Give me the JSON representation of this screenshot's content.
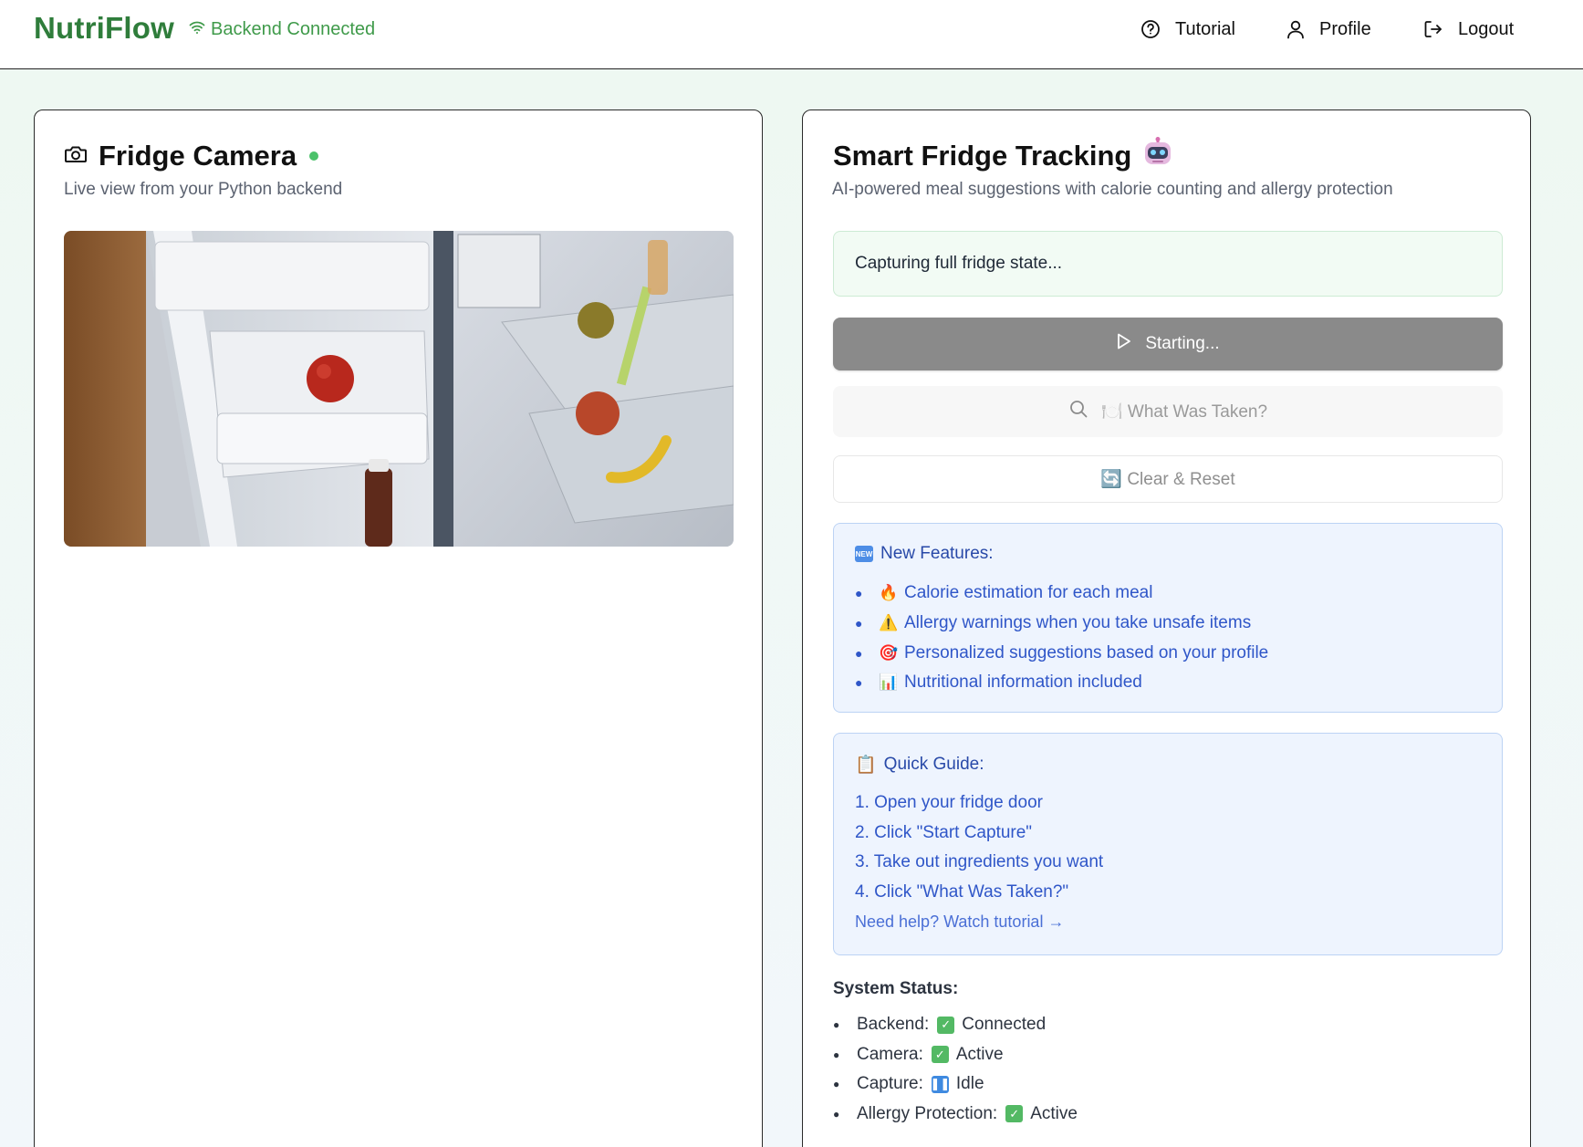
{
  "nav": {
    "brand": "NutriFlow",
    "connection_status": "Backend Connected",
    "tutorial": "Tutorial",
    "profile": "Profile",
    "logout": "Logout"
  },
  "camera_card": {
    "title": "Fridge Camera",
    "subtitle": "Live view from your Python backend",
    "live": true
  },
  "tracking_card": {
    "title": "Smart Fridge Tracking",
    "title_emoji": "🤖",
    "subtitle": "AI-powered meal suggestions with calorie counting and allergy protection",
    "status_message": "Capturing full fridge state...",
    "start_button": "Starting...",
    "what_taken_button": "🍽️ What Was Taken?",
    "clear_button": "🔄 Clear & Reset",
    "features": {
      "icon": "🆕",
      "title": "New Features:",
      "items": [
        {
          "emoji": "🔥",
          "text": "Calorie estimation for each meal"
        },
        {
          "emoji": "⚠️",
          "text": "Allergy warnings when you take unsafe items"
        },
        {
          "emoji": "🎯",
          "text": "Personalized suggestions based on your profile"
        },
        {
          "emoji": "📊",
          "text": "Nutritional information included"
        }
      ]
    },
    "guide": {
      "icon": "📋",
      "title": "Quick Guide:",
      "steps": [
        "1. Open your fridge door",
        "2. Click \"Start Capture\"",
        "3. Take out ingredients you want",
        "4. Click \"What Was Taken?\""
      ],
      "help_link": "Need help? Watch tutorial →"
    },
    "system_status": {
      "title": "System Status:",
      "items": [
        {
          "label": "Backend:",
          "value": "Connected",
          "icon": "check",
          "color": "#53b964"
        },
        {
          "label": "Camera:",
          "value": "Active",
          "icon": "check",
          "color": "#53b964"
        },
        {
          "label": "Capture:",
          "value": "Idle",
          "icon": "pause",
          "color": "#3f8ae0"
        },
        {
          "label": "Allergy Protection:",
          "value": "Active",
          "icon": "check",
          "color": "#53b964"
        }
      ]
    }
  },
  "colors": {
    "brand": "#2f7d3b",
    "connected": "#3f9a4a",
    "info_text": "#2f56c8",
    "start_button_bg": "#8a8a8a"
  }
}
